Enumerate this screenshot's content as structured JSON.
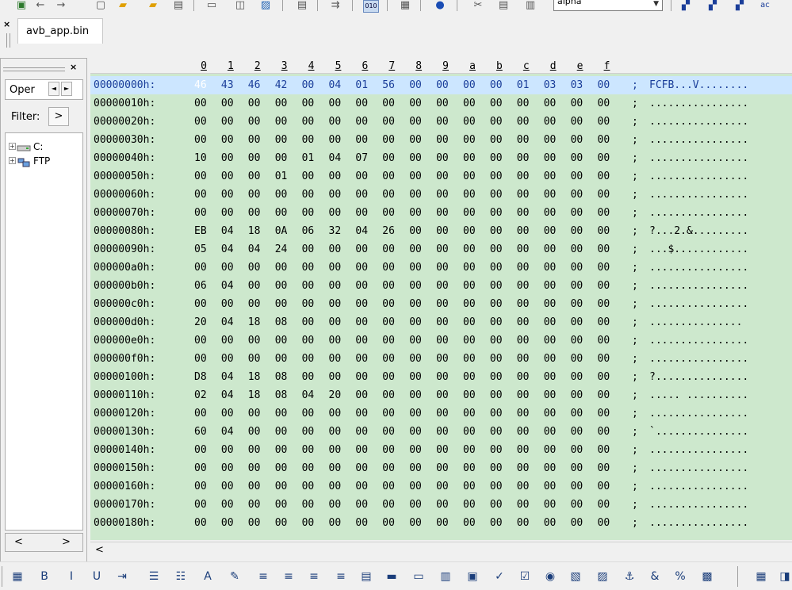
{
  "top_toolbar": {
    "combo_value": "alpha",
    "icons": [
      "new-icon",
      "back-icon",
      "forward-icon",
      "new-file-icon",
      "open-icon",
      "open-folder-icon",
      "save-icon",
      "print-icon",
      "print-preview-icon",
      "image-icon",
      "page-setup-icon",
      "word-wrap-icon",
      "hex-mode-icon",
      "column-icon",
      "help-icon",
      "cut-icon",
      "copy-icon",
      "paste-icon",
      "find-icon",
      "find-next-icon",
      "find-prev-icon",
      "replace-icon"
    ]
  },
  "tab": {
    "close": "×",
    "label": "avb_app.bin"
  },
  "left_panel": {
    "close": "×",
    "tab_label": "Oper",
    "tab_prev": "◄",
    "tab_next": "►",
    "filter_label": "Filter:",
    "filter_button": ">",
    "tree": [
      {
        "label": "C:",
        "icon": "drive-icon"
      },
      {
        "label": "FTP",
        "icon": "ftp-icon"
      }
    ],
    "scroll_left": "<",
    "scroll_right": ">"
  },
  "hex": {
    "columns": [
      "0",
      "1",
      "2",
      "3",
      "4",
      "5",
      "6",
      "7",
      "8",
      "9",
      "a",
      "b",
      "c",
      "d",
      "e",
      "f"
    ],
    "rows": [
      {
        "addr": "00000000h:",
        "bytes": [
          "46",
          "43",
          "46",
          "42",
          "00",
          "04",
          "01",
          "56",
          "00",
          "00",
          "00",
          "00",
          "01",
          "03",
          "03",
          "00"
        ],
        "ascii": "FCFB...V........"
      },
      {
        "addr": "00000010h:",
        "bytes": [
          "00",
          "00",
          "00",
          "00",
          "00",
          "00",
          "00",
          "00",
          "00",
          "00",
          "00",
          "00",
          "00",
          "00",
          "00",
          "00"
        ],
        "ascii": "................"
      },
      {
        "addr": "00000020h:",
        "bytes": [
          "00",
          "00",
          "00",
          "00",
          "00",
          "00",
          "00",
          "00",
          "00",
          "00",
          "00",
          "00",
          "00",
          "00",
          "00",
          "00"
        ],
        "ascii": "................"
      },
      {
        "addr": "00000030h:",
        "bytes": [
          "00",
          "00",
          "00",
          "00",
          "00",
          "00",
          "00",
          "00",
          "00",
          "00",
          "00",
          "00",
          "00",
          "00",
          "00",
          "00"
        ],
        "ascii": "................"
      },
      {
        "addr": "00000040h:",
        "bytes": [
          "10",
          "00",
          "00",
          "00",
          "01",
          "04",
          "07",
          "00",
          "00",
          "00",
          "00",
          "00",
          "00",
          "00",
          "00",
          "00"
        ],
        "ascii": "................"
      },
      {
        "addr": "00000050h:",
        "bytes": [
          "00",
          "00",
          "00",
          "01",
          "00",
          "00",
          "00",
          "00",
          "00",
          "00",
          "00",
          "00",
          "00",
          "00",
          "00",
          "00"
        ],
        "ascii": "................"
      },
      {
        "addr": "00000060h:",
        "bytes": [
          "00",
          "00",
          "00",
          "00",
          "00",
          "00",
          "00",
          "00",
          "00",
          "00",
          "00",
          "00",
          "00",
          "00",
          "00",
          "00"
        ],
        "ascii": "................"
      },
      {
        "addr": "00000070h:",
        "bytes": [
          "00",
          "00",
          "00",
          "00",
          "00",
          "00",
          "00",
          "00",
          "00",
          "00",
          "00",
          "00",
          "00",
          "00",
          "00",
          "00"
        ],
        "ascii": "................"
      },
      {
        "addr": "00000080h:",
        "bytes": [
          "EB",
          "04",
          "18",
          "0A",
          "06",
          "32",
          "04",
          "26",
          "00",
          "00",
          "00",
          "00",
          "00",
          "00",
          "00",
          "00"
        ],
        "ascii": "?...2.&........."
      },
      {
        "addr": "00000090h:",
        "bytes": [
          "05",
          "04",
          "04",
          "24",
          "00",
          "00",
          "00",
          "00",
          "00",
          "00",
          "00",
          "00",
          "00",
          "00",
          "00",
          "00"
        ],
        "ascii": "...$............"
      },
      {
        "addr": "000000a0h:",
        "bytes": [
          "00",
          "00",
          "00",
          "00",
          "00",
          "00",
          "00",
          "00",
          "00",
          "00",
          "00",
          "00",
          "00",
          "00",
          "00",
          "00"
        ],
        "ascii": "................"
      },
      {
        "addr": "000000b0h:",
        "bytes": [
          "06",
          "04",
          "00",
          "00",
          "00",
          "00",
          "00",
          "00",
          "00",
          "00",
          "00",
          "00",
          "00",
          "00",
          "00",
          "00"
        ],
        "ascii": "................"
      },
      {
        "addr": "000000c0h:",
        "bytes": [
          "00",
          "00",
          "00",
          "00",
          "00",
          "00",
          "00",
          "00",
          "00",
          "00",
          "00",
          "00",
          "00",
          "00",
          "00",
          "00"
        ],
        "ascii": "................"
      },
      {
        "addr": "000000d0h:",
        "bytes": [
          "20",
          "04",
          "18",
          "08",
          "00",
          "00",
          "00",
          "00",
          "00",
          "00",
          "00",
          "00",
          "00",
          "00",
          "00",
          "00"
        ],
        "ascii": " ..............."
      },
      {
        "addr": "000000e0h:",
        "bytes": [
          "00",
          "00",
          "00",
          "00",
          "00",
          "00",
          "00",
          "00",
          "00",
          "00",
          "00",
          "00",
          "00",
          "00",
          "00",
          "00"
        ],
        "ascii": "................"
      },
      {
        "addr": "000000f0h:",
        "bytes": [
          "00",
          "00",
          "00",
          "00",
          "00",
          "00",
          "00",
          "00",
          "00",
          "00",
          "00",
          "00",
          "00",
          "00",
          "00",
          "00"
        ],
        "ascii": "................"
      },
      {
        "addr": "00000100h:",
        "bytes": [
          "D8",
          "04",
          "18",
          "08",
          "00",
          "00",
          "00",
          "00",
          "00",
          "00",
          "00",
          "00",
          "00",
          "00",
          "00",
          "00"
        ],
        "ascii": "?..............."
      },
      {
        "addr": "00000110h:",
        "bytes": [
          "02",
          "04",
          "18",
          "08",
          "04",
          "20",
          "00",
          "00",
          "00",
          "00",
          "00",
          "00",
          "00",
          "00",
          "00",
          "00"
        ],
        "ascii": "..... .........."
      },
      {
        "addr": "00000120h:",
        "bytes": [
          "00",
          "00",
          "00",
          "00",
          "00",
          "00",
          "00",
          "00",
          "00",
          "00",
          "00",
          "00",
          "00",
          "00",
          "00",
          "00"
        ],
        "ascii": "................"
      },
      {
        "addr": "00000130h:",
        "bytes": [
          "60",
          "04",
          "00",
          "00",
          "00",
          "00",
          "00",
          "00",
          "00",
          "00",
          "00",
          "00",
          "00",
          "00",
          "00",
          "00"
        ],
        "ascii": "`..............."
      },
      {
        "addr": "00000140h:",
        "bytes": [
          "00",
          "00",
          "00",
          "00",
          "00",
          "00",
          "00",
          "00",
          "00",
          "00",
          "00",
          "00",
          "00",
          "00",
          "00",
          "00"
        ],
        "ascii": "................"
      },
      {
        "addr": "00000150h:",
        "bytes": [
          "00",
          "00",
          "00",
          "00",
          "00",
          "00",
          "00",
          "00",
          "00",
          "00",
          "00",
          "00",
          "00",
          "00",
          "00",
          "00"
        ],
        "ascii": "................"
      },
      {
        "addr": "00000160h:",
        "bytes": [
          "00",
          "00",
          "00",
          "00",
          "00",
          "00",
          "00",
          "00",
          "00",
          "00",
          "00",
          "00",
          "00",
          "00",
          "00",
          "00"
        ],
        "ascii": "................"
      },
      {
        "addr": "00000170h:",
        "bytes": [
          "00",
          "00",
          "00",
          "00",
          "00",
          "00",
          "00",
          "00",
          "00",
          "00",
          "00",
          "00",
          "00",
          "00",
          "00",
          "00"
        ],
        "ascii": "................"
      },
      {
        "addr": "00000180h:",
        "bytes": [
          "00",
          "00",
          "00",
          "00",
          "00",
          "00",
          "00",
          "00",
          "00",
          "00",
          "00",
          "00",
          "00",
          "00",
          "00",
          "00"
        ],
        "ascii": "................"
      }
    ],
    "scroll_left": "<"
  },
  "bottom_toolbar": {
    "icons": [
      {
        "name": "table-icon",
        "glyph": "▦"
      },
      {
        "name": "bold-icon",
        "glyph": "B"
      },
      {
        "name": "italic-icon",
        "glyph": "I"
      },
      {
        "name": "underline-icon",
        "glyph": "U"
      },
      {
        "name": "indent-icon",
        "glyph": "⇥"
      },
      {
        "name": "bullet-list-icon",
        "glyph": "☰"
      },
      {
        "name": "numbered-list-icon",
        "glyph": "☷"
      },
      {
        "name": "font-icon",
        "glyph": "A"
      },
      {
        "name": "color-icon",
        "glyph": "✎"
      },
      {
        "name": "align-left-icon",
        "glyph": "≡"
      },
      {
        "name": "align-center-icon",
        "glyph": "≡"
      },
      {
        "name": "align-right-icon",
        "glyph": "≡"
      },
      {
        "name": "align-justify-icon",
        "glyph": "≡"
      },
      {
        "name": "form-icon",
        "glyph": "▤"
      },
      {
        "name": "horizontal-rule-icon",
        "glyph": "▬"
      },
      {
        "name": "text-field-icon",
        "glyph": "▭"
      },
      {
        "name": "text-area-icon",
        "glyph": "▥"
      },
      {
        "name": "password-icon",
        "glyph": "▣"
      },
      {
        "name": "spell-icon",
        "glyph": "✓"
      },
      {
        "name": "checkbox-icon",
        "glyph": "☑"
      },
      {
        "name": "radio-icon",
        "glyph": "◉"
      },
      {
        "name": "frame-icon",
        "glyph": "▧"
      },
      {
        "name": "image-icon",
        "glyph": "▨"
      },
      {
        "name": "anchor-icon",
        "glyph": "⚓"
      },
      {
        "name": "special-char-icon",
        "glyph": "&"
      },
      {
        "name": "char-count-icon",
        "glyph": "%"
      },
      {
        "name": "encode-icon",
        "glyph": "▩"
      },
      {
        "name": "grid-icon",
        "glyph": "▦"
      },
      {
        "name": "export-icon",
        "glyph": "◨"
      }
    ]
  }
}
